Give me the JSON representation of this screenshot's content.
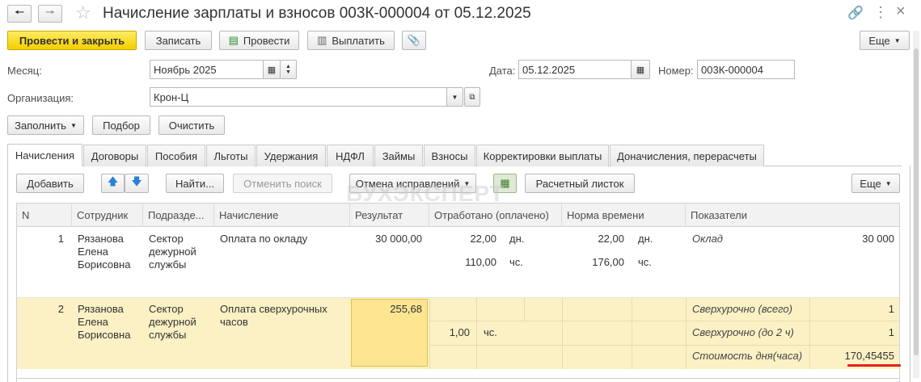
{
  "window": {
    "title": "Начисление зарплаты и взносов 003К-000004 от 05.12.2025"
  },
  "toolbar": {
    "post_close": "Провести и закрыть",
    "save": "Записать",
    "post": "Провести",
    "pay": "Выплатить",
    "more": "Еще"
  },
  "form": {
    "month_label": "Месяц:",
    "month_value": "Ноябрь 2025",
    "date_label": "Дата:",
    "date_value": "05.12.2025",
    "number_label": "Номер:",
    "number_value": "003К-000004",
    "org_label": "Организация:",
    "org_value": "Крон-Ц"
  },
  "actions": {
    "fill": "Заполнить",
    "select": "Подбор",
    "clear": "Очистить"
  },
  "tabs": [
    "Начисления",
    "Договоры",
    "Пособия",
    "Льготы",
    "Удержания",
    "НДФЛ",
    "Займы",
    "Взносы",
    "Корректировки выплаты",
    "Доначисления, перерасчеты"
  ],
  "table_toolbar": {
    "add": "Добавить",
    "find": "Найти...",
    "cancel_search": "Отменить поиск",
    "cancel_fix": "Отмена исправлений",
    "payslip": "Расчетный листок",
    "more": "Еще"
  },
  "watermark": "БУХЭКСПЕРТ",
  "columns": [
    "N",
    "Сотрудник",
    "Подразде...",
    "Начисление",
    "Результат",
    "Отработано (оплачено)",
    "Норма времени",
    "Показатели"
  ],
  "rows": [
    {
      "n": "1",
      "employee": [
        "Рязанова",
        "Елена",
        "Борисовна"
      ],
      "dept": [
        "Сектор",
        "дежурной",
        "службы"
      ],
      "accrual": [
        "Оплата по окладу"
      ],
      "result": "30 000,00",
      "worked1": "22,00",
      "unit1": "дн.",
      "worked2": "110,00",
      "unit2": "чс.",
      "norm1": "22,00",
      "nunit1": "дн.",
      "norm2": "176,00",
      "nunit2": "чс.",
      "ind": [
        {
          "name": "Оклад",
          "value": "30 000"
        }
      ]
    },
    {
      "n": "2",
      "employee": [
        "Рязанова",
        "Елена",
        "Борисовна"
      ],
      "dept": [
        "Сектор",
        "дежурной",
        "службы"
      ],
      "accrual": [
        "Оплата сверхурочных",
        "часов"
      ],
      "result": "255,68",
      "worked": "1,00",
      "unit": "чс.",
      "ind": [
        {
          "name": "Сверхурочно (всего)",
          "value": "1"
        },
        {
          "name": "Сверхурочно (до 2 ч)",
          "value": "1"
        },
        {
          "name": "Стоимость дня(часа)",
          "value": "170,45455"
        }
      ]
    }
  ]
}
